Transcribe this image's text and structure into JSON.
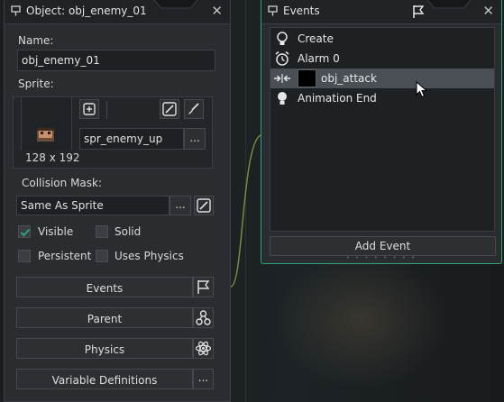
{
  "object_panel": {
    "title": "Object: obj_enemy_01",
    "name_label": "Name:",
    "name_value": "obj_enemy_01",
    "sprite_label": "Sprite:",
    "sprite_name": "spr_enemy_up",
    "sprite_size": "128 x 192",
    "browse_label": "...",
    "collision_mask_label": "Collision Mask:",
    "collision_mask_value": "Same As Sprite",
    "checkboxes": {
      "visible": {
        "label": "Visible",
        "checked": true
      },
      "solid": {
        "label": "Solid",
        "checked": false
      },
      "persistent": {
        "label": "Persistent",
        "checked": false
      },
      "uses_physics": {
        "label": "Uses Physics",
        "checked": false
      }
    },
    "buttons": {
      "events": "Events",
      "parent": "Parent",
      "physics": "Physics",
      "variable_definitions": "Variable Definitions"
    }
  },
  "events_panel": {
    "title": "Events",
    "items": [
      {
        "label": "Create",
        "icon": "lightbulb-icon"
      },
      {
        "label": "Alarm 0",
        "icon": "alarm-clock-icon"
      },
      {
        "label": "obj_attack",
        "icon": "collision-icon",
        "selected": true
      },
      {
        "label": "Animation End",
        "icon": "lightbulb-icon"
      }
    ],
    "add_event_label": "Add Event"
  },
  "colors": {
    "panel_bg": "#2a2d30",
    "events_border_accent": "#2fa27f",
    "checkbox_tick": "#2fa27f",
    "selected_row": "#4a4f55"
  }
}
